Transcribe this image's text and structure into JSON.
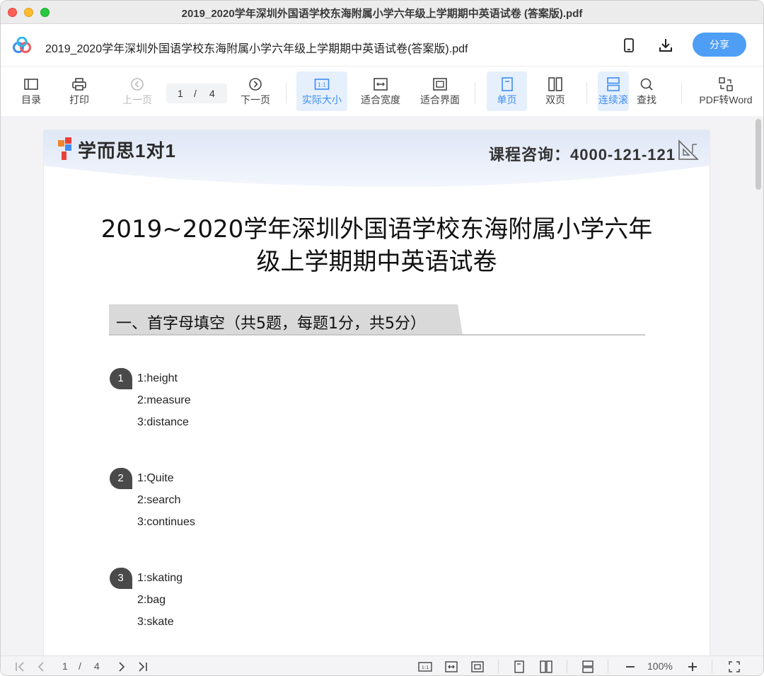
{
  "window": {
    "title": "2019_2020学年深圳外国语学校东海附属小学六年级上学期期中英语试卷 (答案版).pdf"
  },
  "header": {
    "doc_name": "2019_2020学年深圳外国语学校东海附属小学六年级上学期期中英语试卷(答案版).pdf",
    "share_label": "分享",
    "icons": [
      "app-logo-icon",
      "phone-icon",
      "download-icon"
    ]
  },
  "toolbar": {
    "toc": "目录",
    "print": "打印",
    "prev": "上一页",
    "page_current": "1",
    "page_sep": "/",
    "page_total": "4",
    "next": "下一页",
    "actual_size": "实际大小",
    "fit_width": "适合宽度",
    "fit_page": "适合界面",
    "single": "单页",
    "double": "双页",
    "continuous": "连续滚",
    "find": "查找",
    "pdf_to_word": "PDF转Word"
  },
  "pdf_page": {
    "brand": "学而思1对1",
    "hotline": "课程咨询：4000-121-121",
    "title_line1": "2019~2020学年深圳外国语学校东海附属小学六年",
    "title_line2": "级上学期期中英语试卷",
    "section_title": "一、首字母填空（共5题，每题1分，共5分）",
    "questions": [
      {
        "num": "1",
        "answers": [
          "1:height",
          "2:measure",
          "3:distance"
        ]
      },
      {
        "num": "2",
        "answers": [
          "1:Quite",
          "2:search",
          "3:continues"
        ]
      },
      {
        "num": "3",
        "answers": [
          "1:skating",
          "2:bag",
          "3:skate"
        ]
      }
    ]
  },
  "statusbar": {
    "page_current": "1",
    "page_sep": "/",
    "page_total": "4",
    "zoom": "100%"
  },
  "colors": {
    "accent": "#4e9ef5",
    "active_bg": "#e6f0fc",
    "section_bg": "#d9d9d9",
    "badge": "#4a4a4a"
  }
}
